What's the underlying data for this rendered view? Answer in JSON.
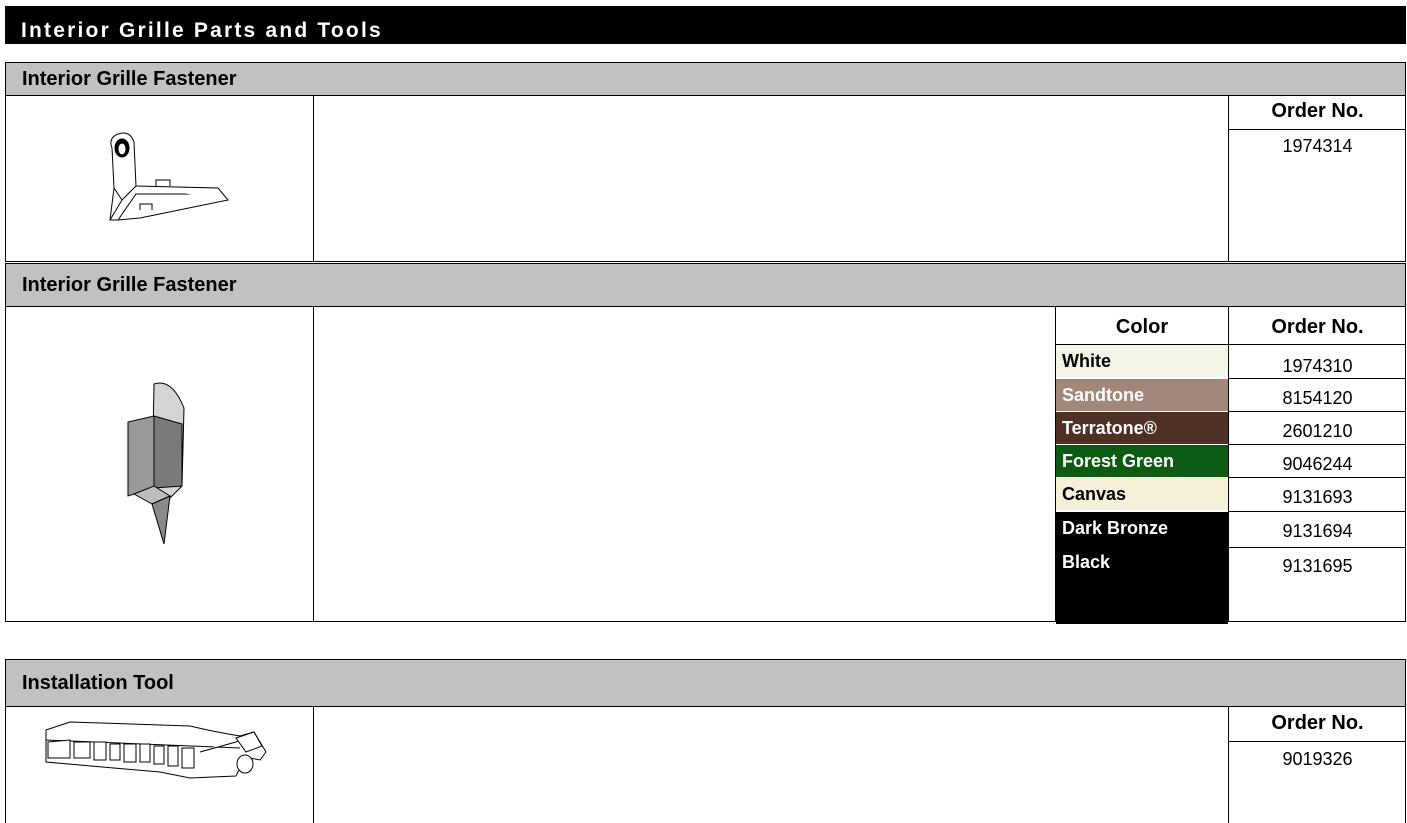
{
  "title": "Interior Grille Parts and Tools",
  "section1": {
    "heading": "Interior Grille Fastener",
    "order_header": "Order No.",
    "order_no": "1974314"
  },
  "section2": {
    "heading": "Interior Grille Fastener",
    "color_header": "Color",
    "order_header": "Order No.",
    "rows": [
      {
        "color": "White",
        "order_no": "1974310",
        "bg": "#f3f3e6",
        "fg": "#000000"
      },
      {
        "color": "Sandtone",
        "order_no": "8154120",
        "bg": "#a0877a",
        "fg": "#ffffff"
      },
      {
        "color": "Terratone®",
        "order_no": "2601210",
        "bg": "#4f3024",
        "fg": "#ffffff"
      },
      {
        "color": "Forest Green",
        "order_no": "9046244",
        "bg": "#0d5a12",
        "fg": "#ffffff"
      },
      {
        "color": "Canvas",
        "order_no": "9131693",
        "bg": "#f6f0d8",
        "fg": "#000000"
      },
      {
        "color": "Dark Bronze",
        "order_no": "9131694",
        "bg": "#000000",
        "fg": "#ffffff"
      },
      {
        "color": "Black",
        "order_no": "9131695",
        "bg": "#000000",
        "fg": "#ffffff"
      }
    ]
  },
  "section3": {
    "heading": "Installation Tool",
    "order_header": "Order No.",
    "order_no": "9019326"
  }
}
